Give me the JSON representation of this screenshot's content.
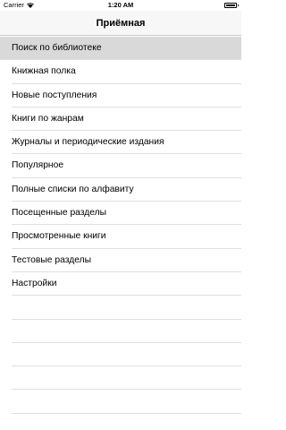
{
  "status_bar": {
    "carrier": "Carrier",
    "time": "1:20 AM",
    "wifi_icon": "wifi-icon",
    "battery_icon": "battery-icon"
  },
  "nav": {
    "title": "Приёмная"
  },
  "menu": {
    "items": [
      {
        "label": "Поиск по библиотеке",
        "selected": true
      },
      {
        "label": "Книжная полка"
      },
      {
        "label": "Новые поступления"
      },
      {
        "label": "Книги по жанрам"
      },
      {
        "label": "Журналы и периодические издания"
      },
      {
        "label": "Популярное"
      },
      {
        "label": "Полные списки по алфавиту"
      },
      {
        "label": "Посещенные разделы"
      },
      {
        "label": "Просмотренные книги"
      },
      {
        "label": "Тестовые разделы"
      },
      {
        "label": "Настройки"
      }
    ]
  },
  "colors": {
    "selected_row": "#d9d9d9",
    "separator": "#e0e0e4",
    "nav_background": "#f7f7f7"
  }
}
